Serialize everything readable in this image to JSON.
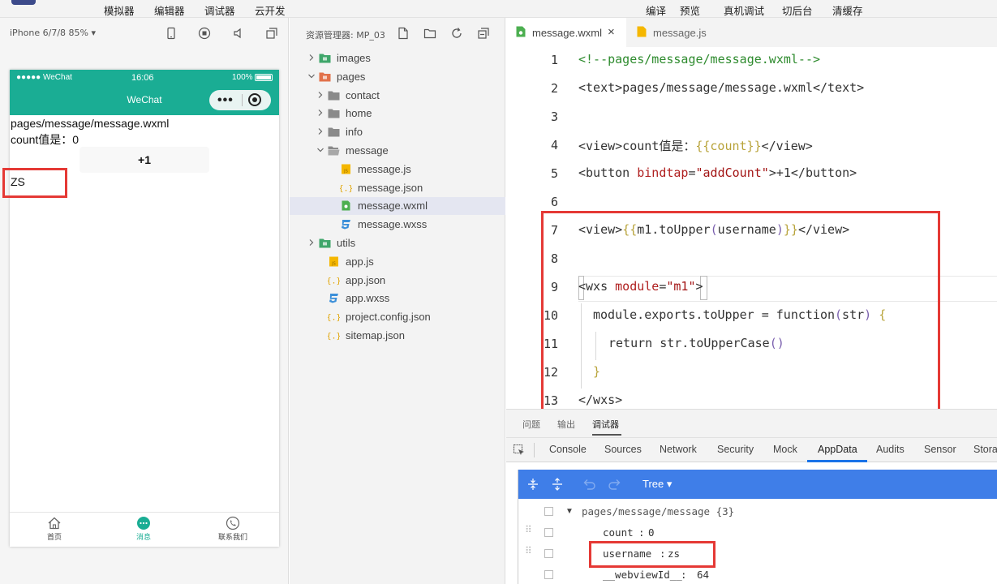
{
  "menu": {
    "left": [
      "模拟器",
      "编辑器",
      "调试器",
      "云开发"
    ],
    "right": [
      "编译",
      "预览",
      "真机调试",
      "切后台",
      "清缓存"
    ]
  },
  "simulator": {
    "device": "iPhone 6/7/8 85% ▾",
    "status": {
      "carrier": "●●●●● WeChat",
      "time": "16:06",
      "battery": "100%"
    },
    "nav_title": "WeChat",
    "page": {
      "path_text": "pages/message/message.wxml",
      "count_text": "count值是：0",
      "button_label": "+1",
      "username_text": "ZS"
    },
    "tabs": [
      "首页",
      "消息",
      "联系我们"
    ],
    "accent": "#1aad94",
    "active_tab_color": "#1aad94"
  },
  "explorer": {
    "title": "资源管理器: MP_03",
    "tree": [
      {
        "name": "images",
        "type": "folder-green",
        "depth": 0,
        "chev": "right"
      },
      {
        "name": "pages",
        "type": "folder-orange",
        "depth": 0,
        "chev": "down"
      },
      {
        "name": "contact",
        "type": "folder",
        "depth": 1,
        "chev": "right"
      },
      {
        "name": "home",
        "type": "folder",
        "depth": 1,
        "chev": "right"
      },
      {
        "name": "info",
        "type": "folder",
        "depth": 1,
        "chev": "right"
      },
      {
        "name": "message",
        "type": "folder-open",
        "depth": 1,
        "chev": "down"
      },
      {
        "name": "message.js",
        "type": "js",
        "depth": 2,
        "chev": ""
      },
      {
        "name": "message.json",
        "type": "json",
        "depth": 2,
        "chev": ""
      },
      {
        "name": "message.wxml",
        "type": "wxml",
        "depth": 2,
        "chev": "",
        "selected": true
      },
      {
        "name": "message.wxss",
        "type": "wxss",
        "depth": 2,
        "chev": ""
      },
      {
        "name": "utils",
        "type": "folder-green",
        "depth": 0,
        "chev": "right"
      },
      {
        "name": "app.js",
        "type": "js",
        "depth": 1,
        "chev": ""
      },
      {
        "name": "app.json",
        "type": "json",
        "depth": 1,
        "chev": ""
      },
      {
        "name": "app.wxss",
        "type": "wxss",
        "depth": 1,
        "chev": ""
      },
      {
        "name": "project.config.json",
        "type": "json",
        "depth": 1,
        "chev": ""
      },
      {
        "name": "sitemap.json",
        "type": "json",
        "depth": 1,
        "chev": ""
      }
    ]
  },
  "editor": {
    "tabs": [
      {
        "name": "message.wxml",
        "close": "×",
        "active": true
      },
      {
        "name": "message.js",
        "close": "",
        "active": false
      }
    ],
    "line_numbers": [
      "1",
      "2",
      "3",
      "4",
      "5",
      "6",
      "7",
      "8",
      "9",
      "10",
      "11",
      "12",
      "13"
    ],
    "lines": {
      "l1": "<!--pages/message/message.wxml-->",
      "l2": "<text>pages/message/message.wxml</text>",
      "l4_a": "<view>count值是：",
      "l4_b": "{{count}}",
      "l4_c": "</view>",
      "l5_a": "<button ",
      "l5_b": "bindtap",
      "l5_c": "=",
      "l5_d": "\"addCount\"",
      "l5_e": ">+1</button>",
      "l7_a": "<view>",
      "l7_b": "{{",
      "l7_c": "m1.toUpper",
      "l7_d": "(",
      "l7_e": "username",
      "l7_f": ")",
      "l7_g": "}}",
      "l7_h": "</view>",
      "l9_a": "<wxs ",
      "l9_b": "module",
      "l9_c": "=",
      "l9_d": "\"m1\"",
      "l9_e": ">",
      "l10_a": "module.exports.toUpper = function",
      "l10_b": "(",
      "l10_c": "str",
      "l10_d": ")",
      "l10_e": " {",
      "l11_a": "return str.toUpperCase",
      "l11_b": "()",
      "l12": "}",
      "l13": "</wxs>"
    }
  },
  "devtools": {
    "top_tabs": [
      "问题",
      "输出",
      "调试器"
    ],
    "tabs": [
      "Console",
      "Sources",
      "Network",
      "Security",
      "Mock",
      "AppData",
      "Audits",
      "Sensor",
      "Stora"
    ],
    "active_tab": "AppData",
    "tree_mode": "Tree ▾",
    "rows": {
      "root": "pages/message/message {3}",
      "count_key": "count",
      "count_val": "0",
      "username_key": "username",
      "username_val": "zs",
      "webview_key": "__webviewId__",
      "webview_val": "64"
    },
    "colon": ":",
    "highlight_color": "#e53935",
    "toolbar_color": "#3f7ee8"
  }
}
